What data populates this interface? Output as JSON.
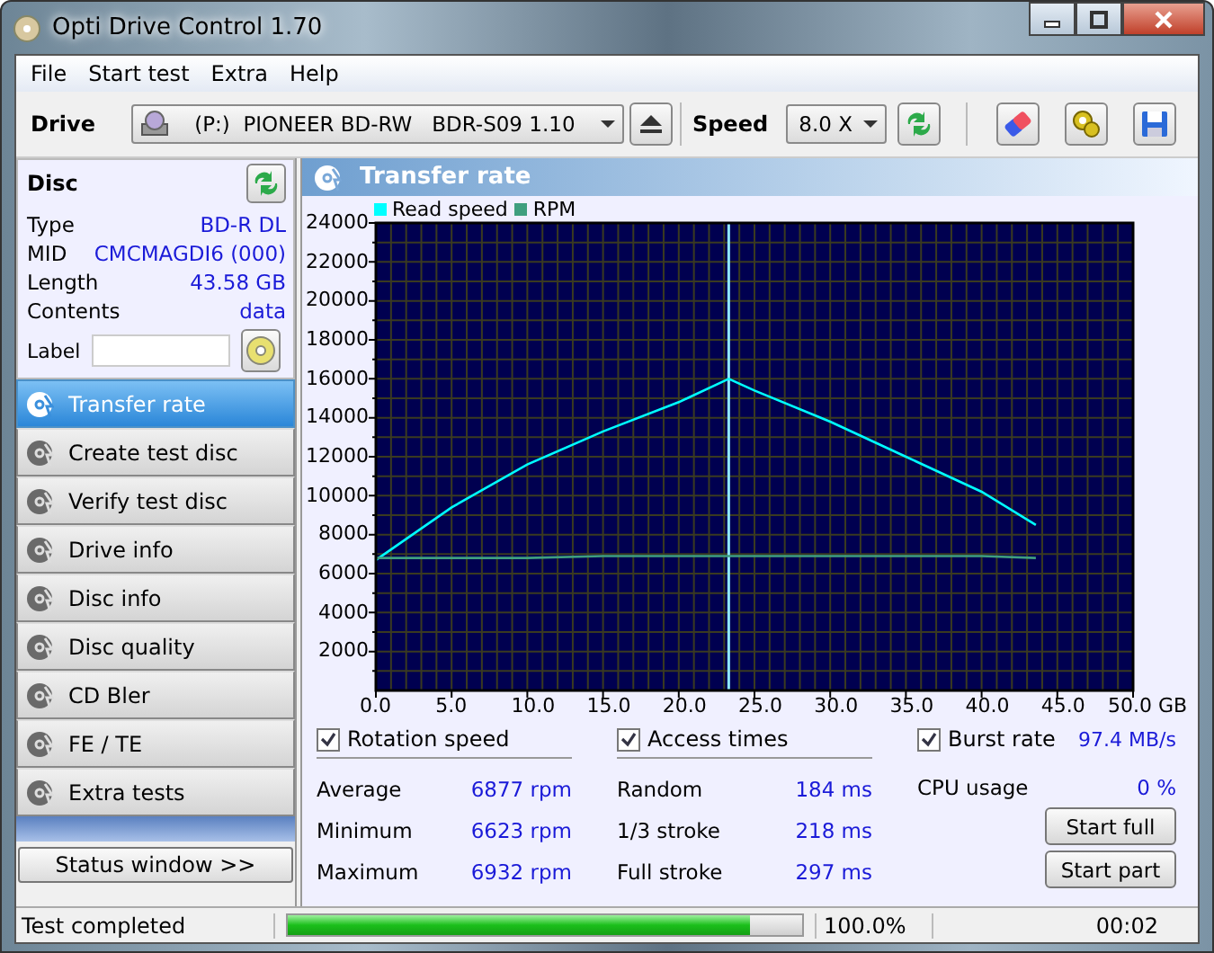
{
  "window": {
    "title": "Opti Drive Control 1.70"
  },
  "menu": [
    "File",
    "Start test",
    "Extra",
    "Help"
  ],
  "toolbar": {
    "drive_label": "Drive",
    "drive": "(P:)  PIONEER BD-RW   BDR-S09 1.10",
    "speed_label": "Speed",
    "speed": "8.0 X"
  },
  "disc": {
    "title": "Disc",
    "fields": [
      {
        "label": "Type",
        "value": "BD-R DL"
      },
      {
        "label": "MID",
        "value": "CMCMAGDI6 (000)"
      },
      {
        "label": "Length",
        "value": "43.58 GB"
      },
      {
        "label": "Contents",
        "value": "data"
      }
    ],
    "label_field": {
      "label": "Label"
    }
  },
  "nav": [
    {
      "label": "Transfer rate",
      "selected": true
    },
    {
      "label": "Create test disc",
      "selected": false
    },
    {
      "label": "Verify test disc",
      "selected": false
    },
    {
      "label": "Drive info",
      "selected": false
    },
    {
      "label": "Disc info",
      "selected": false
    },
    {
      "label": "Disc quality",
      "selected": false
    },
    {
      "label": "CD Bler",
      "selected": false
    },
    {
      "label": "FE / TE",
      "selected": false
    },
    {
      "label": "Extra tests",
      "selected": false
    }
  ],
  "status_window_button": "Status window >>",
  "panel": {
    "title": "Transfer rate",
    "chart_data": {
      "type": "line",
      "x": [
        0,
        5,
        10,
        15,
        20,
        23.3,
        25,
        30,
        35,
        40,
        43.58
      ],
      "series": [
        {
          "name": "Read speed",
          "color": "#00ffff",
          "values": [
            6700,
            9400,
            11600,
            13300,
            14800,
            16000,
            15400,
            13800,
            12000,
            10200,
            8500
          ]
        },
        {
          "name": "RPM",
          "color": "#3f9f7f",
          "values": [
            6800,
            6800,
            6800,
            6900,
            6900,
            6900,
            6900,
            6900,
            6900,
            6900,
            6800
          ]
        }
      ],
      "grid": true,
      "xlim": [
        0,
        50
      ],
      "ylim": [
        0,
        24000
      ],
      "xticks": [
        {
          "value": 0,
          "label": "0.0"
        },
        {
          "value": 5,
          "label": "5.0"
        },
        {
          "value": 10,
          "label": "10.0"
        },
        {
          "value": 15,
          "label": "15.0"
        },
        {
          "value": 20,
          "label": "20.0"
        },
        {
          "value": 25,
          "label": "25.0"
        },
        {
          "value": 30,
          "label": "30.0"
        },
        {
          "value": 35,
          "label": "35.0"
        },
        {
          "value": 40,
          "label": "40.0"
        },
        {
          "value": 45,
          "label": "45.0"
        },
        {
          "value": 50,
          "label": "50.0 GB"
        }
      ],
      "yticks": [
        2000,
        4000,
        6000,
        8000,
        10000,
        12000,
        14000,
        16000,
        18000,
        20000,
        22000,
        24000
      ],
      "legend": "top-left",
      "ref_lines": [
        {
          "axis": "x",
          "value": 23.3,
          "color": "#8fe8ff"
        }
      ]
    }
  },
  "stats": {
    "rotation": {
      "label": "Rotation speed",
      "checked": true,
      "rows": [
        {
          "label": "Average",
          "value": "6877 rpm"
        },
        {
          "label": "Minimum",
          "value": "6623 rpm"
        },
        {
          "label": "Maximum",
          "value": "6932 rpm"
        }
      ]
    },
    "access": {
      "label": "Access times",
      "checked": true,
      "rows": [
        {
          "label": "Random",
          "value": "184 ms"
        },
        {
          "label": "1/3 stroke",
          "value": "218 ms"
        },
        {
          "label": "Full stroke",
          "value": "297 ms"
        }
      ]
    },
    "burst": {
      "label": "Burst rate",
      "checked": true,
      "value": "97.4 MB/s"
    },
    "cpu": {
      "label": "CPU usage",
      "value": "0 %"
    },
    "buttons": [
      "Start full",
      "Start part"
    ]
  },
  "status_bar": {
    "message": "Test completed",
    "progress": {
      "level": 0.9
    },
    "percent": "100.0%",
    "time": "00:02"
  }
}
